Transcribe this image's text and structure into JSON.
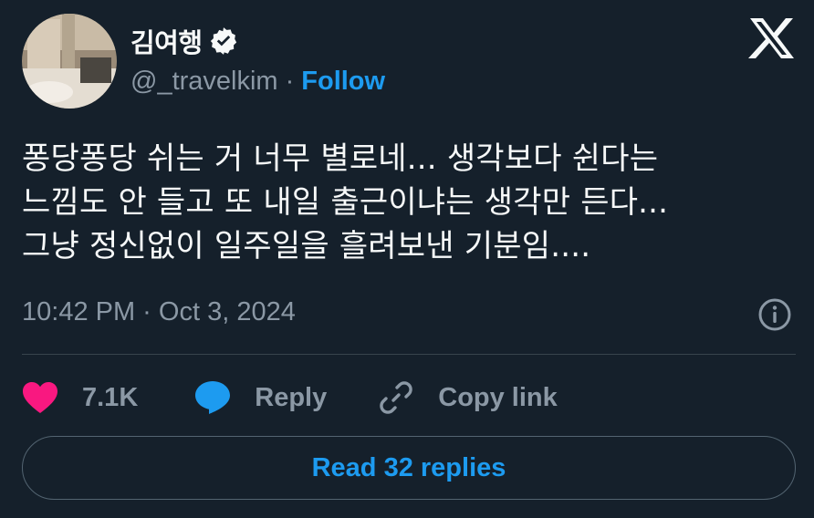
{
  "author": {
    "display_name": "김여행",
    "handle": "@_travelkim",
    "separator": "·",
    "follow_label": "Follow",
    "verified": true
  },
  "tweet": {
    "lines": [
      "퐁당퐁당 쉬는 거 너무 별로네... 생각보다 쉰다는",
      "느낌도 안 들고 또 내일 출근이냐는 생각만 든다...",
      "그냥 정신없이 일주일을 흘려보낸 기분임...."
    ],
    "timestamp": "10:42 PM · Oct 3, 2024"
  },
  "actions": {
    "like_count": "7.1K",
    "reply_label": "Reply",
    "copy_label": "Copy link"
  },
  "read_replies_label": "Read 32 replies",
  "colors": {
    "background": "#15202b",
    "accent": "#1d9bf0",
    "like": "#f91880",
    "muted": "#8b98a5"
  },
  "icons": [
    "verified-badge-icon",
    "x-logo-icon",
    "info-icon",
    "heart-icon",
    "reply-bubble-icon",
    "link-icon"
  ]
}
